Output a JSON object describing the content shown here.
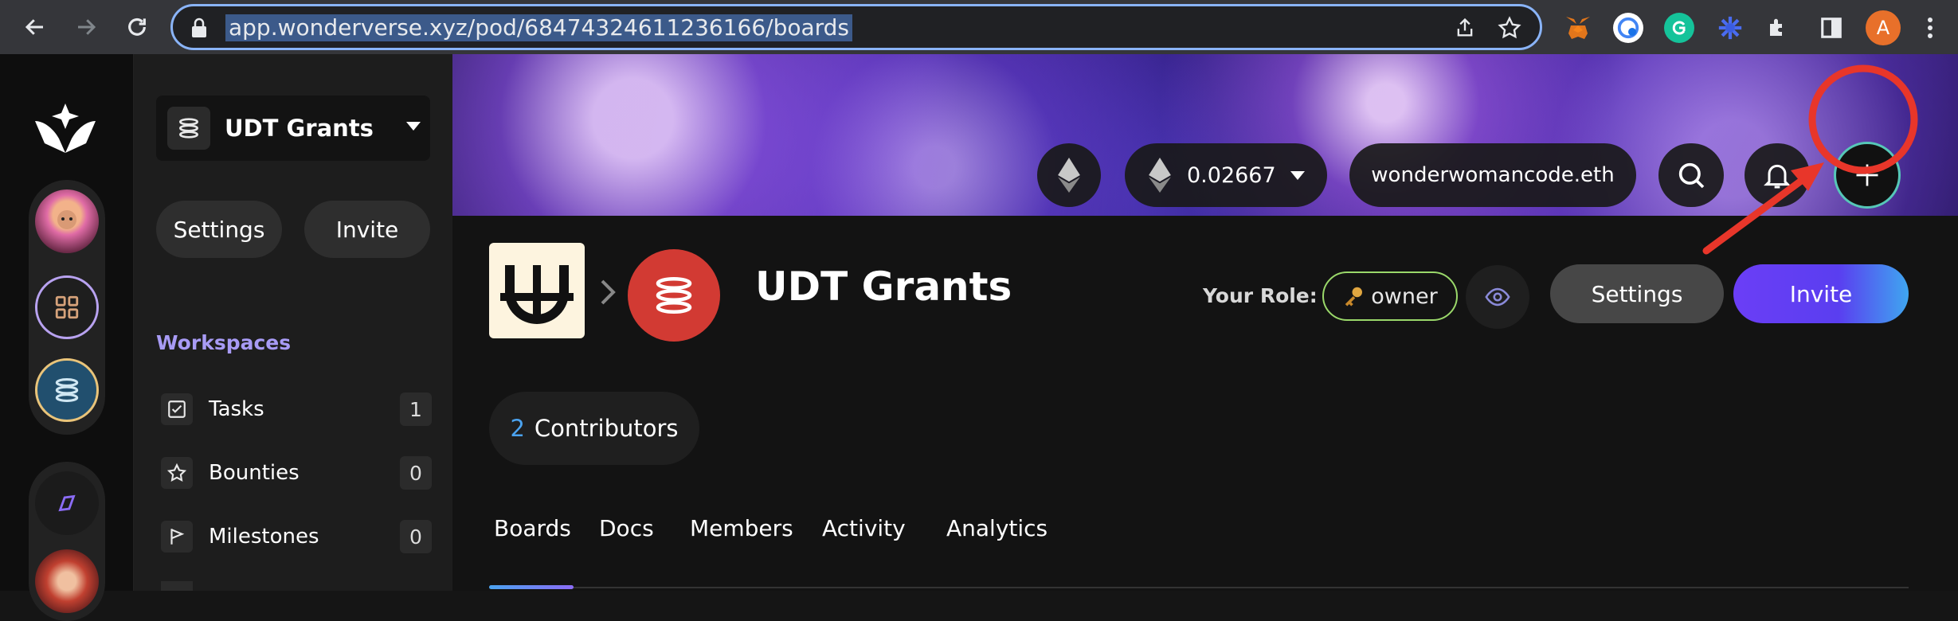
{
  "browser": {
    "url": "app.wonderverse.xyz/pod/68474324611236166/boards",
    "avatar_initial": "A"
  },
  "pod_sidebar": {
    "pod_name": "UDT Grants",
    "settings_label": "Settings",
    "invite_label": "Invite",
    "workspaces_label": "Workspaces",
    "items": [
      {
        "label": "Tasks",
        "count": "1",
        "icon": "checkbox-icon"
      },
      {
        "label": "Bounties",
        "count": "0",
        "icon": "star-icon"
      },
      {
        "label": "Milestones",
        "count": "0",
        "icon": "flag-icon"
      }
    ]
  },
  "header": {
    "balance": "0.02667",
    "wallet": "wonderwomancode.eth"
  },
  "pod": {
    "title": "UDT Grants",
    "role_label": "Your Role:",
    "role": "owner",
    "settings_label": "Settings",
    "invite_label": "Invite",
    "contributors_count": "2",
    "contributors_label": "Contributors"
  },
  "tabs": [
    {
      "label": "Boards",
      "active": true
    },
    {
      "label": "Docs",
      "active": false
    },
    {
      "label": "Members",
      "active": false
    },
    {
      "label": "Activity",
      "active": false
    },
    {
      "label": "Analytics",
      "active": false
    }
  ],
  "colors": {
    "accent": "#6b3ef6",
    "annotation": "#e8362a",
    "role_border": "#9ad86a",
    "pod_logo": "#d23a33"
  }
}
